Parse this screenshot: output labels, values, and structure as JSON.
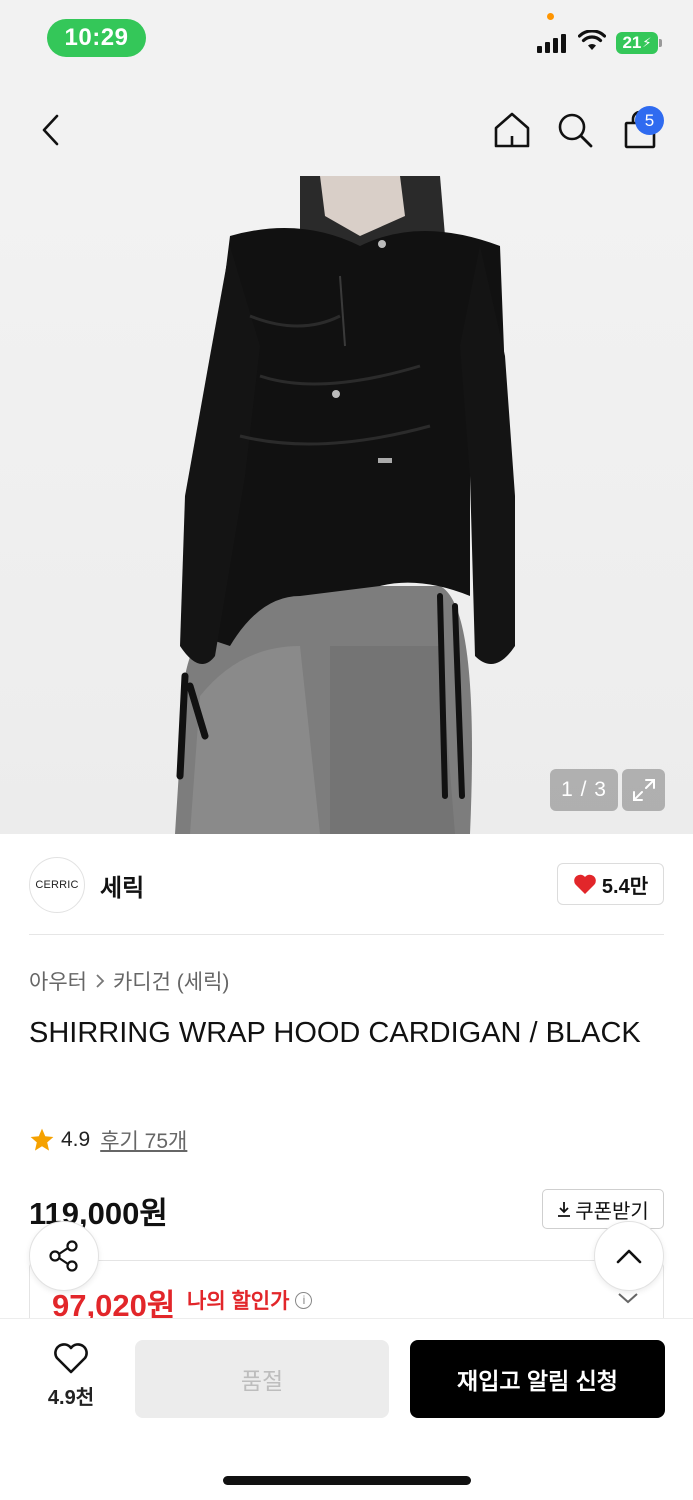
{
  "status_bar": {
    "time": "10:29",
    "battery": "21"
  },
  "header": {
    "icons": [
      "back-icon",
      "home-icon",
      "search-icon",
      "shopping-bag-icon"
    ],
    "cart_badge": "5"
  },
  "gallery": {
    "counter": "1 / 3",
    "current": 1,
    "total": 3
  },
  "brand": {
    "logo_text": "CERRIC",
    "name": "세릭",
    "likes": "5.4만"
  },
  "product": {
    "breadcrumb": [
      "아우터",
      "카디건 (세릭)"
    ],
    "title": "SHIRRING WRAP HOOD CARDIGAN / BLACK",
    "rating": "4.9",
    "reviews": "후기 75개",
    "price": "119,000원",
    "coupon_label": "쿠폰받기",
    "discount_price": "97,020원",
    "discount_label": "나의 할인가"
  },
  "bottom_bar": {
    "wish_count": "4.9천",
    "soldout_label": "품절",
    "restock_label": "재입고 알림 신청"
  },
  "colors": {
    "accent_red": "#e2262a",
    "badge_blue": "#2f6bf0",
    "status_green": "#34c759",
    "star": "#f5a100"
  }
}
